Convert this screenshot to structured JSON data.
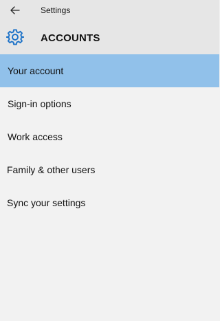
{
  "titlebar": {
    "back_icon": "back-arrow-icon",
    "title": "Settings"
  },
  "header": {
    "icon": "gear-icon",
    "accent_color": "#1e73c8",
    "section_title": "ACCOUNTS"
  },
  "nav": {
    "selected_color": "#91c1ea",
    "items": [
      {
        "label": "Your account",
        "selected": true
      },
      {
        "label": "Sign-in options",
        "selected": false
      },
      {
        "label": "Work access",
        "selected": false
      },
      {
        "label": "Family & other users",
        "selected": false
      },
      {
        "label": "Sync your settings",
        "selected": false
      }
    ]
  }
}
